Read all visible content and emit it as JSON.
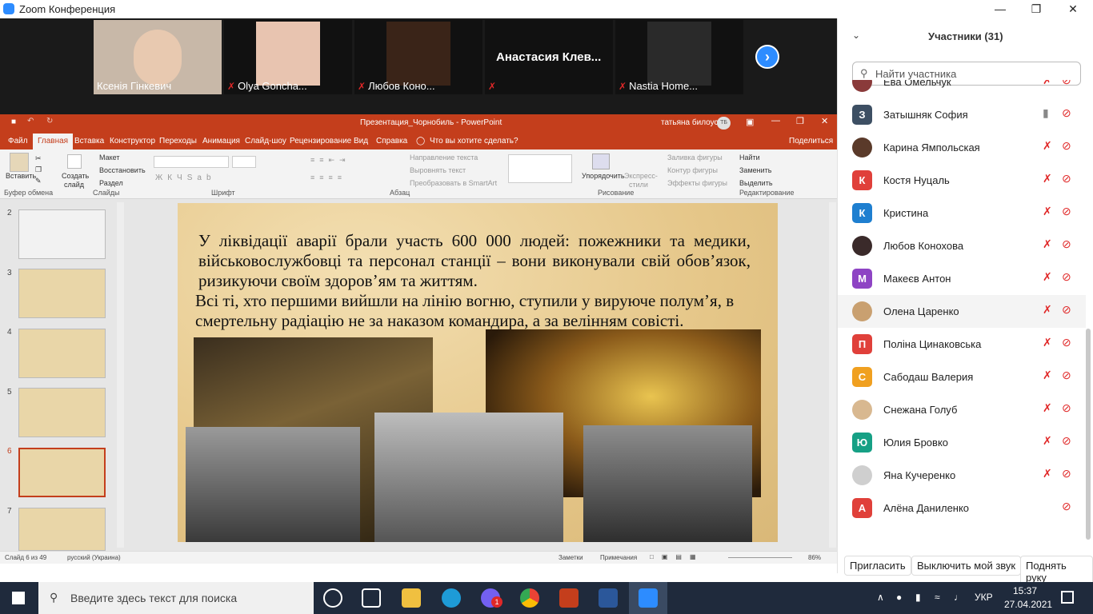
{
  "zoom": {
    "title": "Zoom Конференция"
  },
  "videos": [
    {
      "name": "Ксенія Гінкевич",
      "muted": false
    },
    {
      "name": "Olya Goncha...",
      "muted": true
    },
    {
      "name": "Любов Коно...",
      "muted": true
    },
    {
      "name": "Анастасия Клев...",
      "muted": true
    },
    {
      "name": "Nastia Home...",
      "muted": true
    }
  ],
  "ppt": {
    "title": "Презентация_Чорнобиль - PowerPoint",
    "user": "татьяна билоус",
    "user_initials": "ТБ",
    "tabs": [
      "Файл",
      "Главная",
      "Вставка",
      "Конструктор",
      "Переходы",
      "Анимация",
      "Слайд-шоу",
      "Рецензирование",
      "Вид",
      "Справка",
      "Что вы хотите сделать?",
      "Поделиться"
    ],
    "groups": [
      "Буфер обмена",
      "Слайды",
      "Шрифт",
      "Абзац",
      "Рисование",
      "Редактирование"
    ],
    "ribbon": {
      "paste": "Вставить",
      "create": "Создать",
      "slide": "слайд",
      "layout": "Макет",
      "restore": "Восстановить",
      "section": "Раздел",
      "text_dir": "Направление текста",
      "align_text": "Выровнять текст",
      "smartart": "Преобразовать в SmartArt",
      "arrange": "Упорядочить",
      "quick_styles": "Экспресс-",
      "styles": "стили",
      "fill": "Заливка фигуры",
      "outline": "Контур фигуры",
      "effects": "Эффекты фигуры",
      "find": "Найти",
      "replace": "Заменить",
      "select": "Выделить"
    },
    "slide_numbers": [
      "2",
      "3",
      "4",
      "5",
      "6",
      "7"
    ],
    "slide": {
      "para1": "У ліквідації аварії брали участь 600 000 людей: пожежники та медики, військовослужбовці та персонал станції – вони виконували свій обов’язок, ризикуючи своїм здоров’ям та життям.",
      "para2": "Всі ті, хто першими вийшли на лінію вогню, ступили у вируюче полум’я, в смертельну радіацію не за наказом командира, а за велінням совісті."
    },
    "status": {
      "slide": "Слайд 6 из 49",
      "lang": "русский (Украина)",
      "notes": "Заметки",
      "comments": "Примечания",
      "zoom": "86%"
    }
  },
  "panel": {
    "title": "Участники (31)",
    "search_placeholder": "Найти участника",
    "participants": [
      {
        "name": "Ева Омельчук",
        "initial": "",
        "color": "#8a3a3a",
        "mic": "muted"
      },
      {
        "name": "Затышняк София",
        "initial": "З",
        "color": "#3d4f63",
        "mic": "on"
      },
      {
        "name": "Карина Ямпольская",
        "initial": "",
        "color": "#5a3a2a",
        "mic": "muted"
      },
      {
        "name": "Костя Нуцаль",
        "initial": "К",
        "color": "#e0403a",
        "mic": "muted"
      },
      {
        "name": "Кристина",
        "initial": "К",
        "color": "#1e7fd0",
        "mic": "muted"
      },
      {
        "name": "Любов Конохова",
        "initial": "",
        "color": "#3a2a2a",
        "mic": "muted"
      },
      {
        "name": "Макеєв Антон",
        "initial": "М",
        "color": "#8e44c4",
        "mic": "muted"
      },
      {
        "name": "Олена Царенко",
        "initial": "",
        "color": "#c9a070",
        "mic": "muted"
      },
      {
        "name": "Поліна Цинаковська",
        "initial": "П",
        "color": "#e0403a",
        "mic": "muted"
      },
      {
        "name": "Сабодаш Валерия",
        "initial": "С",
        "color": "#f0a020",
        "mic": "muted"
      },
      {
        "name": "Снежана Голуб",
        "initial": "",
        "color": "#d8b890",
        "mic": "muted"
      },
      {
        "name": "Юлия Бровко",
        "initial": "Ю",
        "color": "#16a085",
        "mic": "muted"
      },
      {
        "name": "Яна Кучеренко",
        "initial": "",
        "color": "#cfcfcf",
        "mic": "muted"
      },
      {
        "name": "Алёна Даниленко",
        "initial": "А",
        "color": "#e0403a",
        "mic": "none"
      }
    ],
    "invite": "Пригласить",
    "mute_me": "Выключить мой звук",
    "raise_hand": "Поднять руку"
  },
  "taskbar": {
    "search": "Введите здесь текст для поиска",
    "lang": "УКР",
    "time": "15:37",
    "date": "27.04.2021",
    "badge": "1"
  }
}
